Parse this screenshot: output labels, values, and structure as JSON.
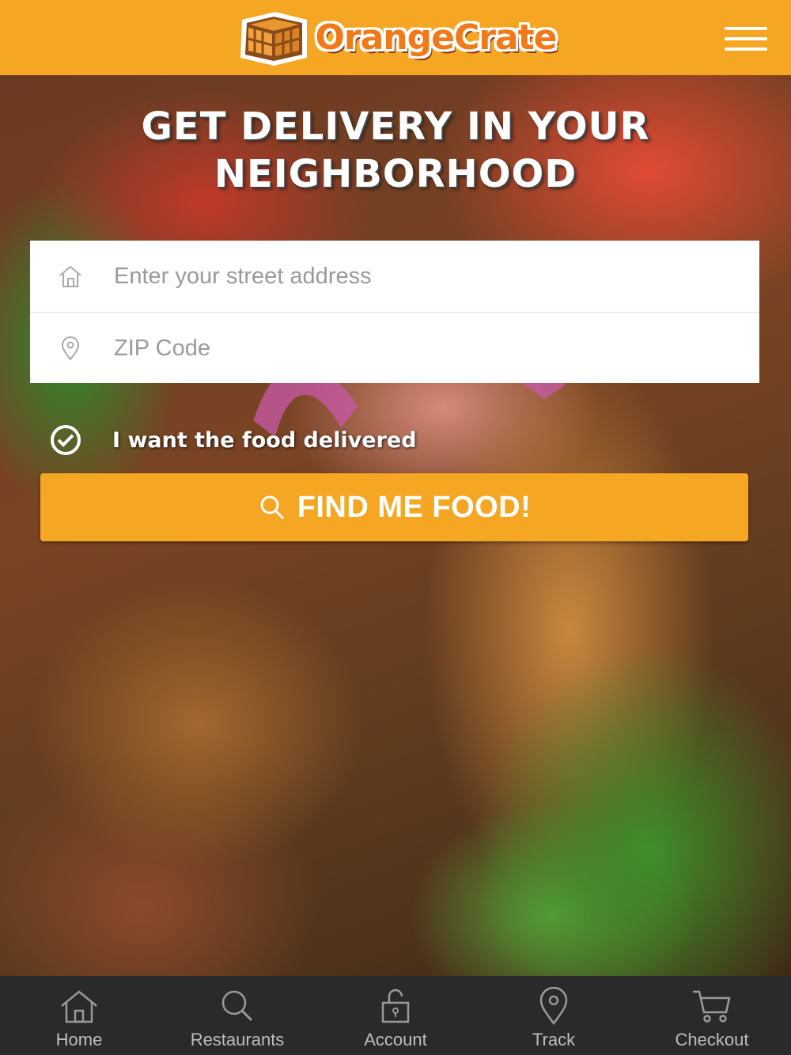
{
  "header": {
    "brand_name": "OrangeCrate",
    "menu_icon": "hamburger-menu-icon"
  },
  "hero": {
    "title_line1": "GET DELIVERY IN YOUR",
    "title_line2": "NEIGHBORHOOD"
  },
  "form": {
    "address_placeholder": "Enter your street address",
    "address_value": "",
    "address_icon": "home-icon",
    "zip_placeholder": "ZIP Code",
    "zip_value": "",
    "zip_icon": "map-pin-icon",
    "delivery_checkbox_label": "I want the food delivered",
    "delivery_checked": true,
    "find_button_label": "FIND ME FOOD!",
    "find_button_icon": "search-icon"
  },
  "bottom_nav": {
    "items": [
      {
        "label": "Home",
        "icon": "home-icon"
      },
      {
        "label": "Restaurants",
        "icon": "search-icon"
      },
      {
        "label": "Account",
        "icon": "lock-icon"
      },
      {
        "label": "Track",
        "icon": "map-pin-icon"
      },
      {
        "label": "Checkout",
        "icon": "cart-icon"
      }
    ]
  },
  "colors": {
    "brand_orange": "#f5a623",
    "logo_text": "#f07a1a",
    "nav_background": "#2a2a2a"
  }
}
